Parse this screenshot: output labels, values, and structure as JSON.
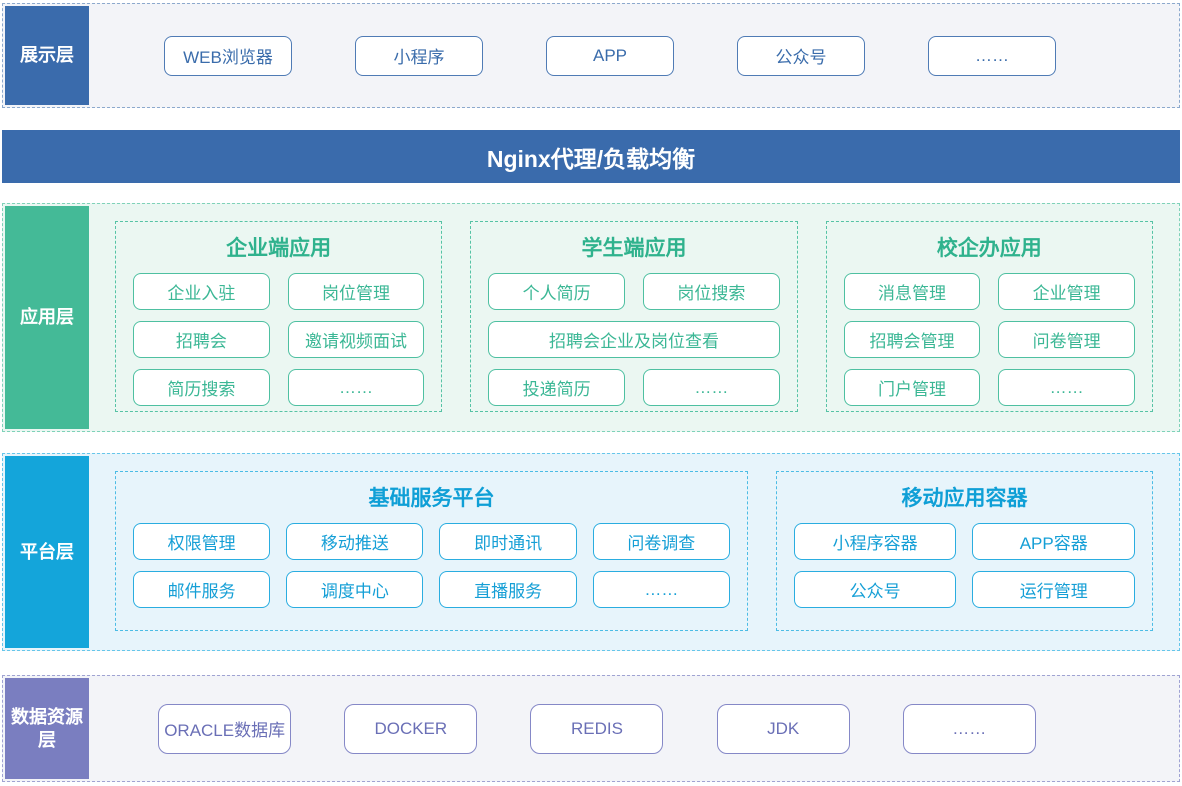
{
  "colors": {
    "blue": "#3a6bac",
    "blue-dash": "#8ca9cd",
    "gray-bg": "#f3f4f8",
    "green": "#44ba97",
    "green-dash": "#7fd2b9",
    "green-bg": "#ebf7f2",
    "cyan": "#14a5da",
    "cyan-dash": "#66c6ea",
    "cyan-bg": "#e7f4fb",
    "purple": "#7a7ec0",
    "purple-dash": "#a0a3d3"
  },
  "presentation": {
    "label": "展示层",
    "items": [
      "WEB浏览器",
      "小程序",
      "APP",
      "公众号",
      "……"
    ]
  },
  "nginx": {
    "title": "Nginx代理/负载均衡"
  },
  "application": {
    "label": "应用层",
    "groups": [
      {
        "title": "企业端应用",
        "rows": [
          [
            "企业入驻",
            "岗位管理"
          ],
          [
            "招聘会",
            "邀请视频面试"
          ],
          [
            "简历搜索",
            "……"
          ]
        ]
      },
      {
        "title": "学生端应用",
        "rows": [
          [
            "个人简历",
            "岗位搜索"
          ],
          [
            "招聘会企业及岗位查看"
          ],
          [
            "投递简历",
            "……"
          ]
        ]
      },
      {
        "title": "校企办应用",
        "rows": [
          [
            "消息管理",
            "企业管理"
          ],
          [
            "招聘会管理",
            "问卷管理"
          ],
          [
            "门户管理",
            "……"
          ]
        ]
      }
    ]
  },
  "platform": {
    "label": "平台层",
    "groups": [
      {
        "title": "基础服务平台",
        "rows": [
          [
            "权限管理",
            "移动推送",
            "即时通讯",
            "问卷调查"
          ],
          [
            "邮件服务",
            "调度中心",
            "直播服务",
            "……"
          ]
        ]
      },
      {
        "title": "移动应用容器",
        "rows": [
          [
            "小程序容器",
            "APP容器"
          ],
          [
            "公众号",
            "运行管理"
          ]
        ]
      }
    ]
  },
  "data_layer": {
    "label": "数据资源层",
    "items": [
      "ORACLE数据库",
      "DOCKER",
      "REDIS",
      "JDK",
      "……"
    ]
  }
}
